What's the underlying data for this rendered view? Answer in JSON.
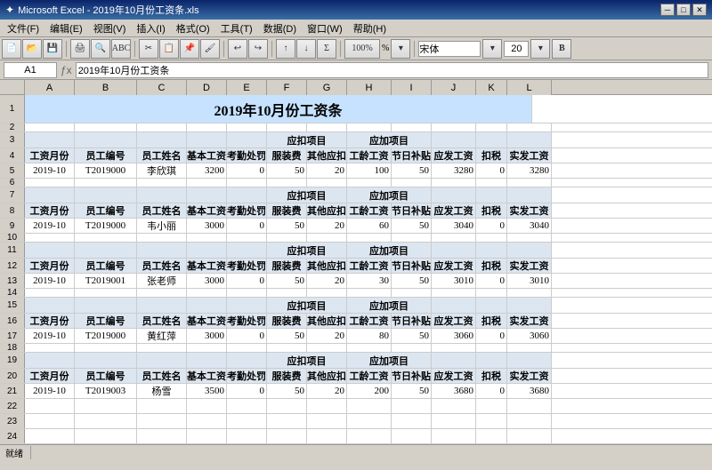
{
  "window": {
    "title": "Microsoft Excel - 2019年10月份工资条.xls"
  },
  "menubar": {
    "items": [
      "文件(F)",
      "编辑(E)",
      "视图(V)",
      "插入(I)",
      "格式(O)",
      "工具(T)",
      "数据(D)",
      "窗口(W)",
      "帮助(H)"
    ]
  },
  "formula_bar": {
    "cell_ref": "A1",
    "formula": "2019年10月份工资条"
  },
  "toolbar2": {
    "zoom": "100%",
    "font": "宋体",
    "font_size": "20",
    "bold": "B"
  },
  "spreadsheet": {
    "title_row": "2019年10月份工资条",
    "col_headers": [
      "A",
      "B",
      "C",
      "D",
      "E",
      "F",
      "G",
      "H",
      "I",
      "J",
      "K",
      "L"
    ],
    "header_labels": {
      "wage_month": "工资月份",
      "emp_id": "员工编号",
      "emp_name": "员工姓名",
      "base_salary": "基本工资",
      "attendance": "考勤处罚",
      "deduct_group": "应扣项目",
      "clothing": "服装费",
      "other_deduct": "其他应扣",
      "add_group": "应加项目",
      "seniority": "工龄工资",
      "holiday": "节日补贴",
      "payable": "应发工资",
      "tax": "扣税",
      "actual": "实发工资"
    },
    "employees": [
      {
        "month": "2019-10",
        "emp_id": "T2019000",
        "emp_name": "李欣琪",
        "base": "3200",
        "attendance": "0",
        "clothing": "50",
        "other_deduct": "20",
        "seniority": "100",
        "holiday": "50",
        "payable": "3280",
        "tax": "0",
        "actual": "3280"
      },
      {
        "month": "2019-10",
        "emp_id": "T2019000",
        "emp_name": "韦小丽",
        "base": "3000",
        "attendance": "0",
        "clothing": "50",
        "other_deduct": "20",
        "seniority": "60",
        "holiday": "50",
        "payable": "3040",
        "tax": "0",
        "actual": "3040"
      },
      {
        "month": "2019-10",
        "emp_id": "T2019001",
        "emp_name": "张老师",
        "base": "3000",
        "attendance": "0",
        "clothing": "50",
        "other_deduct": "20",
        "seniority": "30",
        "holiday": "50",
        "payable": "3010",
        "tax": "0",
        "actual": "3010"
      },
      {
        "month": "2019-10",
        "emp_id": "T2019000",
        "emp_name": "黄红萍",
        "base": "3000",
        "attendance": "0",
        "clothing": "50",
        "other_deduct": "20",
        "seniority": "80",
        "holiday": "50",
        "payable": "3060",
        "tax": "0",
        "actual": "3060"
      },
      {
        "month": "2019-10",
        "emp_id": "T2019003",
        "emp_name": "杨雪",
        "base": "3500",
        "attendance": "0",
        "clothing": "50",
        "other_deduct": "20",
        "seniority": "200",
        "holiday": "50",
        "payable": "3680",
        "tax": "0",
        "actual": "3680"
      }
    ],
    "row_numbers": [
      "1",
      "2",
      "3",
      "4",
      "5",
      "6",
      "7",
      "8",
      "9",
      "10",
      "11",
      "12",
      "13",
      "14",
      "15",
      "16",
      "17",
      "18",
      "19",
      "20",
      "21",
      "22",
      "23",
      "24"
    ]
  },
  "statusbar": {
    "ready": "就绪"
  }
}
